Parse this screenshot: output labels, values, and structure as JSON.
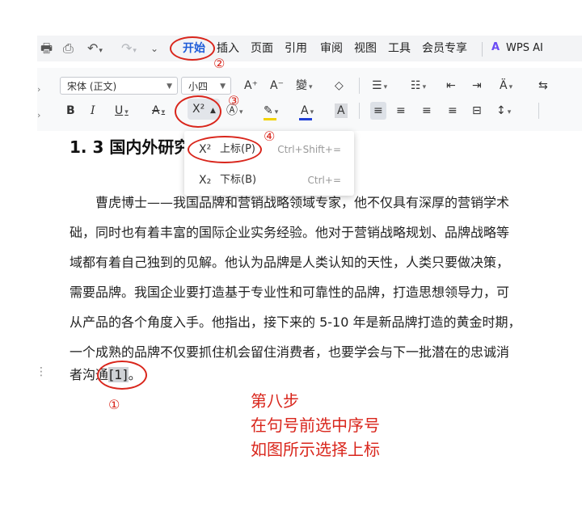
{
  "menubar": {
    "items": [
      "开始",
      "插入",
      "页面",
      "引用",
      "审阅",
      "视图",
      "工具",
      "会员专享"
    ],
    "ai_label": "WPS AI"
  },
  "toolbar": {
    "font_name": "宋体 (正文)",
    "font_size": "小四",
    "superscript_label": "X²"
  },
  "dropdown": {
    "superscript": {
      "icon": "X²",
      "label": "上标(P)",
      "shortcut": "Ctrl+Shift+="
    },
    "subscript": {
      "icon": "X₂",
      "label": "下标(B)",
      "shortcut": "Ctrl+="
    }
  },
  "document": {
    "heading": "1. 3 国内外研究",
    "lines": [
      "曹虎博士——我国品牌和营销战略领域专家，他不仅具有深厚的营销学术",
      "础，同时也有着丰富的国际企业实务经验。他对于营销战略规划、品牌战略等",
      "域都有着自己独到的见解。他认为品牌是人类认知的天性，人类只要做决策，",
      "需要品牌。我国企业要打造基于专业性和可靠性的品牌，打造思想领导力，可",
      "从产品的各个角度入手。他指出，接下来的 5-10 年是新品牌打造的黄金时期，",
      "一个成熟的品牌不仅要抓住机会留住消费者，也要学会与下一批潜在的忠诚消"
    ],
    "last_line_text": "者沟通",
    "reference": "[1]",
    "last_line_end": "。"
  },
  "annotations": {
    "markers": [
      "①",
      "②",
      "③",
      "④"
    ],
    "note_lines": [
      "第八步",
      "在句号前选中序号",
      "如图所示选择上标"
    ]
  },
  "colors": {
    "annotation": "#d9261c",
    "active_tab": "#1d5bd8",
    "font_color_bar": "#1f3fd6",
    "highlight_bar": "#f2d200"
  }
}
